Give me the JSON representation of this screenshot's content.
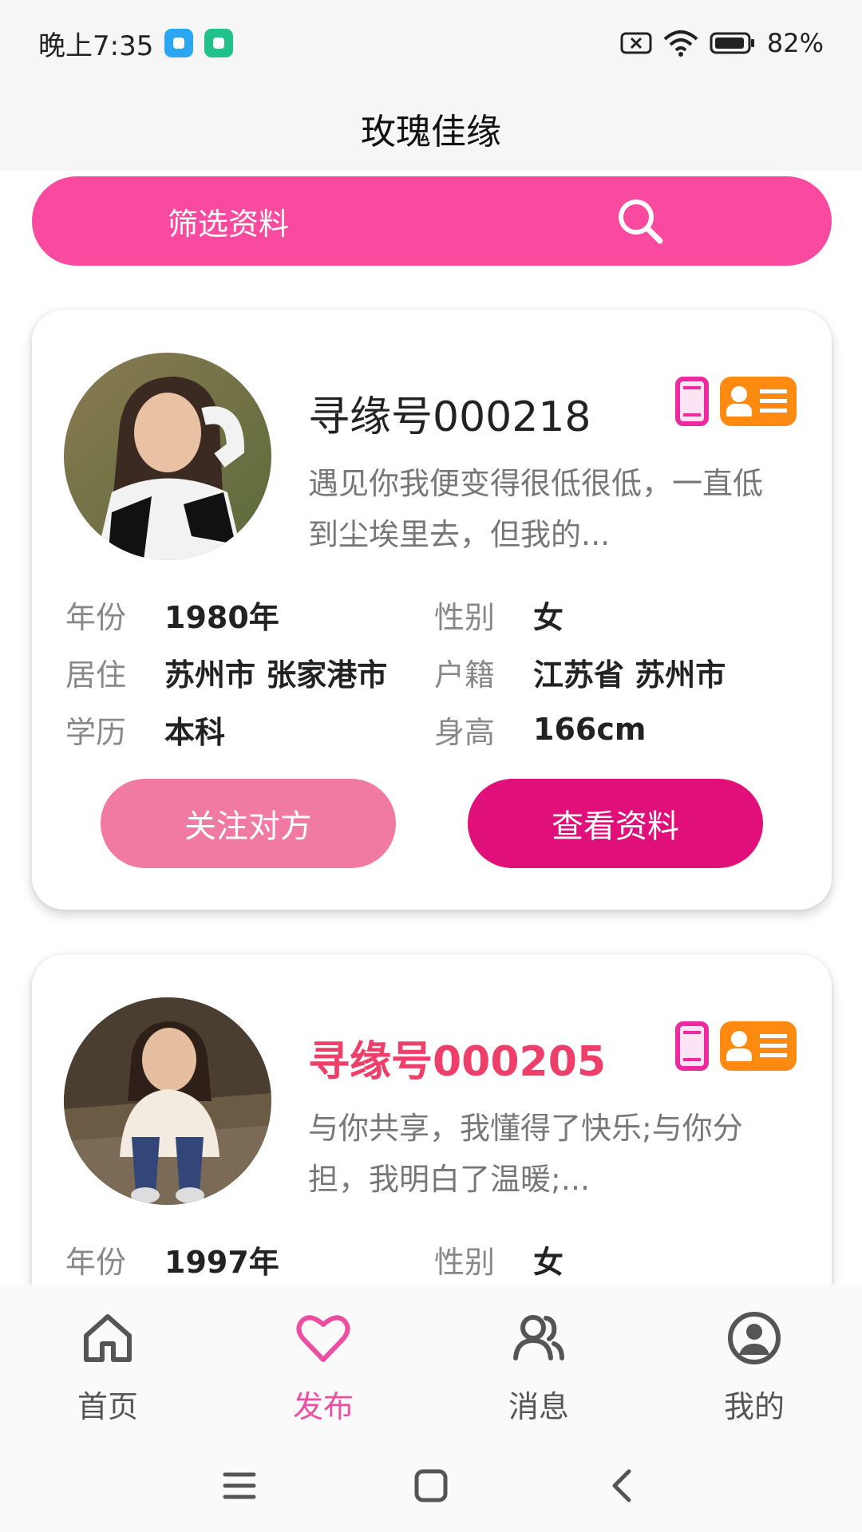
{
  "status_bar": {
    "time": "晚上7:35",
    "battery": "82%",
    "icons": [
      "app-blue-icon",
      "app-green-icon",
      "sim-off-icon",
      "wifi-icon",
      "battery-icon"
    ]
  },
  "header": {
    "title": "玫瑰佳缘"
  },
  "filter": {
    "label": "筛选资料",
    "icon": "search-icon"
  },
  "profiles": [
    {
      "id_label": "寻缘号000218",
      "description": "遇见你我便变得很低很低，一直低到尘埃里去，但我的...",
      "fields": [
        {
          "label": "年份",
          "value": "1980年"
        },
        {
          "label": "性别",
          "value": "女"
        },
        {
          "label": "居住",
          "value": "苏州市 张家港市"
        },
        {
          "label": "户籍",
          "value": "江苏省 苏州市"
        },
        {
          "label": "学历",
          "value": "本科"
        },
        {
          "label": "身高",
          "value": "166cm"
        }
      ],
      "follow_label": "关注对方",
      "view_label": "查看资料"
    },
    {
      "id_label": "寻缘号000205",
      "description": "与你共享，我懂得了快乐;与你分担，我明白了温暖;...",
      "fields": [
        {
          "label": "年份",
          "value": "1997年"
        },
        {
          "label": "性别",
          "value": "女"
        }
      ]
    }
  ],
  "nav": {
    "items": [
      {
        "label": "首页",
        "icon": "home-icon"
      },
      {
        "label": "发布",
        "icon": "heart-icon",
        "active": true
      },
      {
        "label": "消息",
        "icon": "users-icon"
      },
      {
        "label": "我的",
        "icon": "profile-icon"
      }
    ]
  },
  "colors": {
    "accent": "#fa4aa0",
    "primary_button": "#e10f7a",
    "secondary_button": "#f07aa2",
    "highlight_text": "#ee3f6a",
    "id_badge": "#ff8a12"
  }
}
